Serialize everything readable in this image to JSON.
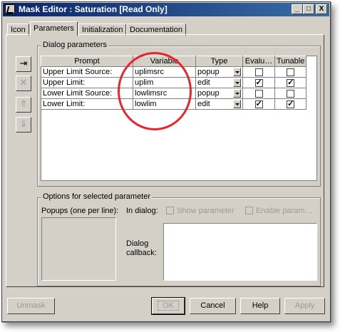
{
  "window": {
    "title": "Mask Editor : Saturation [Read Only]",
    "controls": {
      "minimize": "_",
      "maximize": "□",
      "close": "X"
    }
  },
  "tabs": [
    {
      "label": "Icon"
    },
    {
      "label": "Parameters",
      "active": true
    },
    {
      "label": "Initialization"
    },
    {
      "label": "Documentation"
    }
  ],
  "dialog_params": {
    "group_label": "Dialog parameters",
    "columns": [
      "Prompt",
      "Variable",
      "Type",
      "Evalu…",
      "Tunable"
    ],
    "rows": [
      {
        "prompt": "Upper Limit Source:",
        "variable": "uplimsrc",
        "type": "popup",
        "evaluate": false,
        "tunable": false
      },
      {
        "prompt": "Upper Limit:",
        "variable": "uplim",
        "type": "edit",
        "evaluate": true,
        "tunable": true
      },
      {
        "prompt": "Lower Limit Source:",
        "variable": "lowlimsrc",
        "type": "popup",
        "evaluate": false,
        "tunable": false
      },
      {
        "prompt": "Lower Limit:",
        "variable": "lowlim",
        "type": "edit",
        "evaluate": true,
        "tunable": true
      }
    ]
  },
  "side_buttons": [
    {
      "icon": "add-row-icon",
      "enabled": true
    },
    {
      "icon": "delete-icon",
      "enabled": false
    },
    {
      "icon": "move-up-icon",
      "enabled": false
    },
    {
      "icon": "move-down-icon",
      "enabled": false
    }
  ],
  "options": {
    "group_label": "Options for selected parameter",
    "popups_label": "Popups (one per line):",
    "in_dialog_label": "In dialog:",
    "show_parameter_label": "Show parameter",
    "enable_param_label": "Enable param…",
    "callback_label_1": "Dialog",
    "callback_label_2": "callback:"
  },
  "buttons": {
    "unmask": "Unmask",
    "ok": "OK",
    "cancel": "Cancel",
    "help": "Help",
    "apply": "Apply"
  },
  "colors": {
    "titlebar_start": "#0a246a",
    "titlebar_end": "#3a6ea5",
    "highlight_ellipse": "#e8262d",
    "face": "#d4d0c8"
  }
}
